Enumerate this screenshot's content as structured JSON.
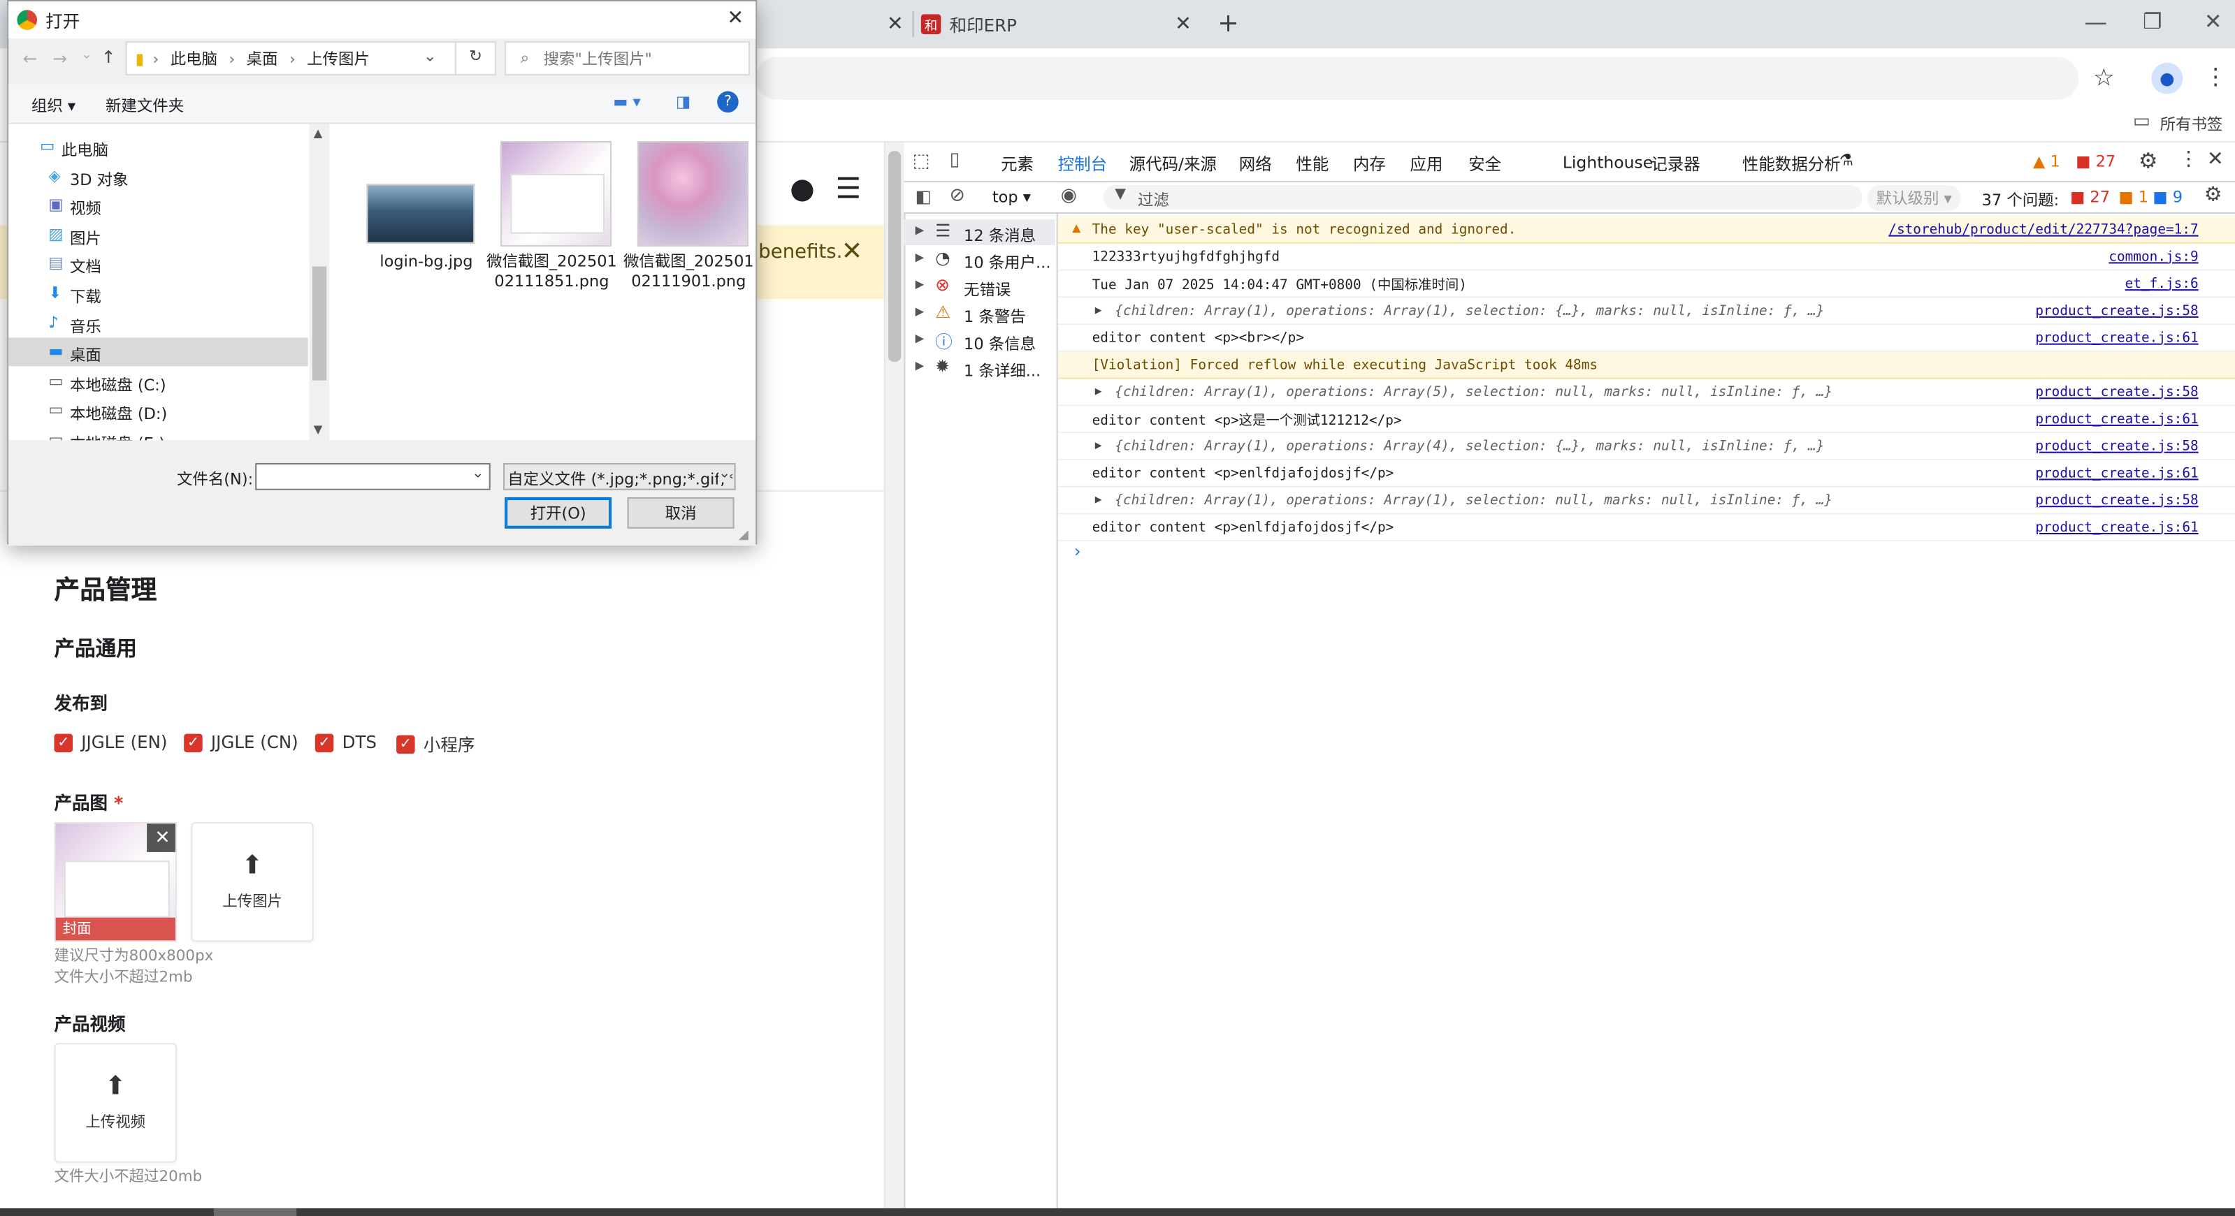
{
  "browser": {
    "tabs": [
      {
        "label": "",
        "active": false
      },
      {
        "label": "和印ERP",
        "active": false
      }
    ],
    "new_tab_symbol": "+",
    "bookmarks_label": "所有书签"
  },
  "page": {
    "banner_text": "benefits.",
    "heading_main": "产品管理",
    "heading_general": "产品通用",
    "publish_label": "发布到",
    "publish_targets": [
      "JJGLE (EN)",
      "JJGLE (CN)",
      "DTS",
      "小程序"
    ],
    "product_image_label": "产品图",
    "required_mark": "*",
    "cover_label": "封面",
    "upload_image_label": "上传图片",
    "image_hint_size": "建议尺寸为800x800px",
    "image_hint_file": "文件大小不超过2mb",
    "product_video_label": "产品视频",
    "upload_video_label": "上传视频",
    "video_hint_file": "文件大小不超过20mb"
  },
  "devtools": {
    "tabs": [
      "元素",
      "控制台",
      "源代码/来源",
      "网络",
      "性能",
      "内存",
      "应用",
      "安全",
      "Lighthouse",
      "记录器",
      "性能数据分析"
    ],
    "active_tab": "控制台",
    "warn_count": "1",
    "error_count": "27",
    "context": "top",
    "filter_placeholder": "过滤",
    "level_label": "默认级别",
    "issues_label": "37 个问题:",
    "issues_err": "27",
    "issues_warn": "1",
    "issues_info": "9",
    "sidebar": [
      {
        "label": "12 条消息",
        "icon": "list-icon"
      },
      {
        "label": "10 条用户...",
        "icon": "user-icon"
      },
      {
        "label": "无错误",
        "icon": "error-icon"
      },
      {
        "label": "1 条警告",
        "icon": "warning-icon"
      },
      {
        "label": "10 条信息",
        "icon": "info-icon"
      },
      {
        "label": "1 条详细...",
        "icon": "bug-icon"
      }
    ],
    "console_rows": [
      {
        "msg": "The key \"user-scaled\" is not recognized and ignored.",
        "src": "/storehub/product/edit/227734?page=1:7",
        "kind": "warn"
      },
      {
        "msg": "122333rtyujhgfdfghjhgfd",
        "src": "common.js:9",
        "kind": "log"
      },
      {
        "msg": "Tue Jan 07 2025 14:04:47 GMT+0800 (中国标准时间)",
        "src": "et_f.js:6",
        "kind": "log"
      },
      {
        "msg": "{children: Array(1), operations: Array(1), selection: {…}, marks: null, isInline: ƒ, …}",
        "src": "product_create.js:58",
        "kind": "obj"
      },
      {
        "msg": "editor content <p><br></p>",
        "src": "product_create.js:61",
        "kind": "log"
      },
      {
        "msg": "[Violation] Forced reflow while executing JavaScript took 48ms",
        "src": "",
        "kind": "violation"
      },
      {
        "msg": "{children: Array(1), operations: Array(5), selection: null, marks: null, isInline: ƒ, …}",
        "src": "product_create.js:58",
        "kind": "obj"
      },
      {
        "msg": "editor content <p>这是一个测试121212</p>",
        "src": "product_create.js:61",
        "kind": "log"
      },
      {
        "msg": "{children: Array(1), operations: Array(4), selection: {…}, marks: null, isInline: ƒ, …}",
        "src": "product_create.js:58",
        "kind": "obj"
      },
      {
        "msg": "editor content <p>enlfdjafojdosjf</p>",
        "src": "product_create.js:61",
        "kind": "log"
      },
      {
        "msg": "{children: Array(1), operations: Array(1), selection: null, marks: null, isInline: ƒ, …}",
        "src": "product_create.js:58",
        "kind": "obj"
      },
      {
        "msg": "editor content <p>enlfdjafojdosjf</p>",
        "src": "product_create.js:61",
        "kind": "log"
      }
    ],
    "prompt": "›"
  },
  "dialog": {
    "title": "打开",
    "breadcrumb": [
      "此电脑",
      "桌面",
      "上传图片"
    ],
    "search_placeholder": "搜索\"上传图片\"",
    "organize_label": "组织 ▾",
    "new_folder_label": "新建文件夹",
    "tree": [
      {
        "label": "此电脑",
        "icon": "computer-icon",
        "indent": 0,
        "selected": false
      },
      {
        "label": "3D 对象",
        "icon": "cube-icon",
        "indent": 1,
        "selected": false
      },
      {
        "label": "视频",
        "icon": "video-icon",
        "indent": 1,
        "selected": false
      },
      {
        "label": "图片",
        "icon": "picture-icon",
        "indent": 1,
        "selected": false
      },
      {
        "label": "文档",
        "icon": "document-icon",
        "indent": 1,
        "selected": false
      },
      {
        "label": "下载",
        "icon": "download-icon",
        "indent": 1,
        "selected": false
      },
      {
        "label": "音乐",
        "icon": "music-icon",
        "indent": 1,
        "selected": false
      },
      {
        "label": "桌面",
        "icon": "desktop-icon",
        "indent": 1,
        "selected": true
      },
      {
        "label": "本地磁盘 (C:)",
        "icon": "disk-icon",
        "indent": 1,
        "selected": false
      },
      {
        "label": "本地磁盘 (D:)",
        "icon": "disk-icon",
        "indent": 1,
        "selected": false
      },
      {
        "label": "本地磁盘 (E:)",
        "icon": "disk-icon",
        "indent": 1,
        "selected": false
      }
    ],
    "files": [
      {
        "name": "login-bg.jpg"
      },
      {
        "name": "微信截图_20250102111851.png"
      },
      {
        "name": "微信截图_20250102111901.png"
      }
    ],
    "filename_label": "文件名(N):",
    "filename_value": "",
    "filetype_value": "自定义文件 (*.jpg;*.png;*.gif;*.",
    "open_button": "打开(O)",
    "cancel_button": "取消"
  }
}
